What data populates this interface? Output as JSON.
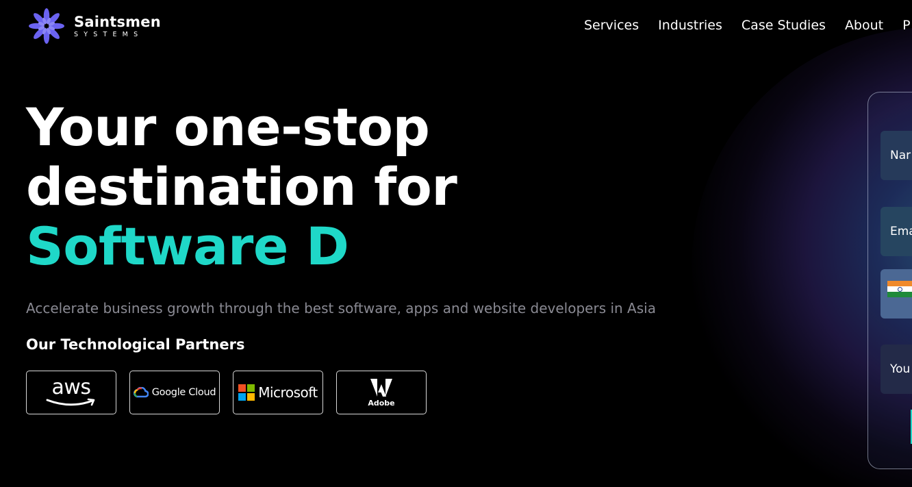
{
  "header": {
    "logo_name": "Saintsmen",
    "logo_sub": "SYSTEMS",
    "nav": [
      "Services",
      "Industries",
      "Case Studies",
      "About",
      "P"
    ]
  },
  "hero": {
    "title_line1": "Your one-stop",
    "title_line2": "destination for",
    "title_accent": "Software D",
    "subtitle": "Accelerate business growth through the best software, apps and website developers in Asia"
  },
  "partners": {
    "title": "Our Technological Partners",
    "items": [
      {
        "name": "aws",
        "icon": "aws-logo"
      },
      {
        "name": "Google Cloud",
        "icon": "google-cloud-logo"
      },
      {
        "name": "Microsoft",
        "icon": "microsoft-logo"
      },
      {
        "name": "Adobe",
        "icon": "adobe-logo"
      }
    ]
  },
  "form": {
    "name_placeholder": "Nar",
    "email_placeholder": "Ema",
    "phone_flag": "india-flag-icon",
    "message_placeholder": "You"
  },
  "colors": {
    "accent": "#1fd8c8",
    "background": "#000000",
    "logo_purple": "#6b63f0"
  }
}
